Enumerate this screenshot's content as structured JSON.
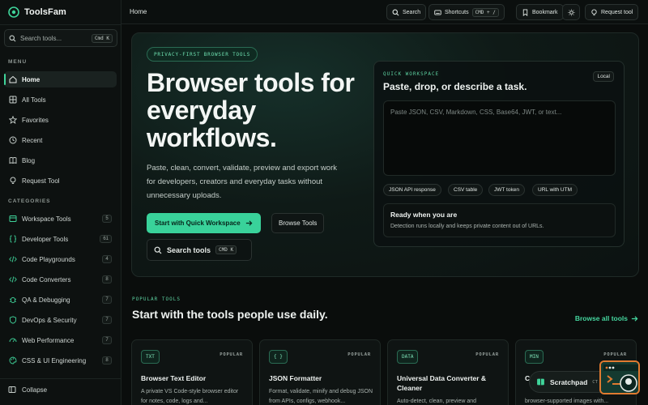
{
  "app": {
    "name": "ToolsFam"
  },
  "sidebar": {
    "search_placeholder": "Search tools...",
    "search_shortcut": "Cmd K",
    "menu_heading": "MENU",
    "menu": [
      {
        "label": "Home",
        "icon": "home-icon",
        "active": true
      },
      {
        "label": "All Tools",
        "icon": "grid-icon"
      },
      {
        "label": "Favorites",
        "icon": "star-icon"
      },
      {
        "label": "Recent",
        "icon": "clock-icon"
      },
      {
        "label": "Blog",
        "icon": "book-icon"
      },
      {
        "label": "Request Tool",
        "icon": "lightbulb-icon"
      }
    ],
    "categories_heading": "CATEGORIES",
    "categories": [
      {
        "label": "Workspace Tools",
        "count": "5",
        "icon": "layout-icon"
      },
      {
        "label": "Developer Tools",
        "count": "61",
        "icon": "braces-icon"
      },
      {
        "label": "Code Playgrounds",
        "count": "4",
        "icon": "code-icon"
      },
      {
        "label": "Code Converters",
        "count": "8",
        "icon": "code-icon"
      },
      {
        "label": "QA & Debugging",
        "count": "7",
        "icon": "bug-icon"
      },
      {
        "label": "DevOps & Security",
        "count": "7",
        "icon": "shield-icon"
      },
      {
        "label": "Web Performance",
        "count": "7",
        "icon": "gauge-icon"
      },
      {
        "label": "CSS & UI Engineering",
        "count": "8",
        "icon": "palette-icon"
      }
    ],
    "collapse_label": "Collapse"
  },
  "topbar": {
    "breadcrumb": "Home",
    "search_label": "Search",
    "shortcuts_label": "Shortcuts",
    "shortcuts_kbd": "CMD + /",
    "bookmark_label": "Bookmark",
    "request_label": "Request tool"
  },
  "hero": {
    "pill": "PRIVACY-FIRST BROWSER TOOLS",
    "title": "Browser tools for everyday workflows.",
    "subtitle": "Paste, clean, convert, validate, preview and export work for developers, creators and everyday tasks without unnecessary uploads.",
    "primary_cta": "Start with Quick Workspace",
    "secondary_cta": "Browse Tools",
    "search_label": "Search tools",
    "search_kbd": "CMD K"
  },
  "workspace": {
    "eyebrow": "QUICK WORKSPACE",
    "title": "Paste, drop, or describe a task.",
    "badge": "Local",
    "placeholder": "Paste JSON, CSV, Markdown, CSS, Base64, JWT, or text...",
    "chips": [
      "JSON API response",
      "CSV table",
      "JWT token",
      "URL with UTM"
    ],
    "status_title": "Ready when you are",
    "status_desc": "Detection runs locally and keeps private content out of URLs."
  },
  "popular": {
    "eyebrow": "POPULAR TOOLS",
    "title": "Start with the tools people use daily.",
    "browse_all": "Browse all tools",
    "cards": [
      {
        "tag": "TXT",
        "badge": "POPULAR",
        "name": "Browser Text Editor",
        "desc": "A private VS Code-style browser editor for notes, code, logs and..."
      },
      {
        "tag": "{ }",
        "badge": "POPULAR",
        "name": "JSON Formatter",
        "desc": "Format, validate, minify and debug JSON from APIs, configs, webhook..."
      },
      {
        "tag": "DATA",
        "badge": "POPULAR",
        "name": "Universal Data Converter & Cleaner",
        "desc": "Auto-detect, clean, preview and"
      },
      {
        "tag": "MIN",
        "badge": "POPULAR",
        "name": "Co",
        "desc": "browser-supported images with..."
      }
    ]
  },
  "scratchpad": {
    "label": "Scratchpad",
    "kbd": "CT"
  },
  "colors": {
    "accent": "#39d29a",
    "background": "#0a0d0c",
    "fab_border": "#e07a30"
  }
}
